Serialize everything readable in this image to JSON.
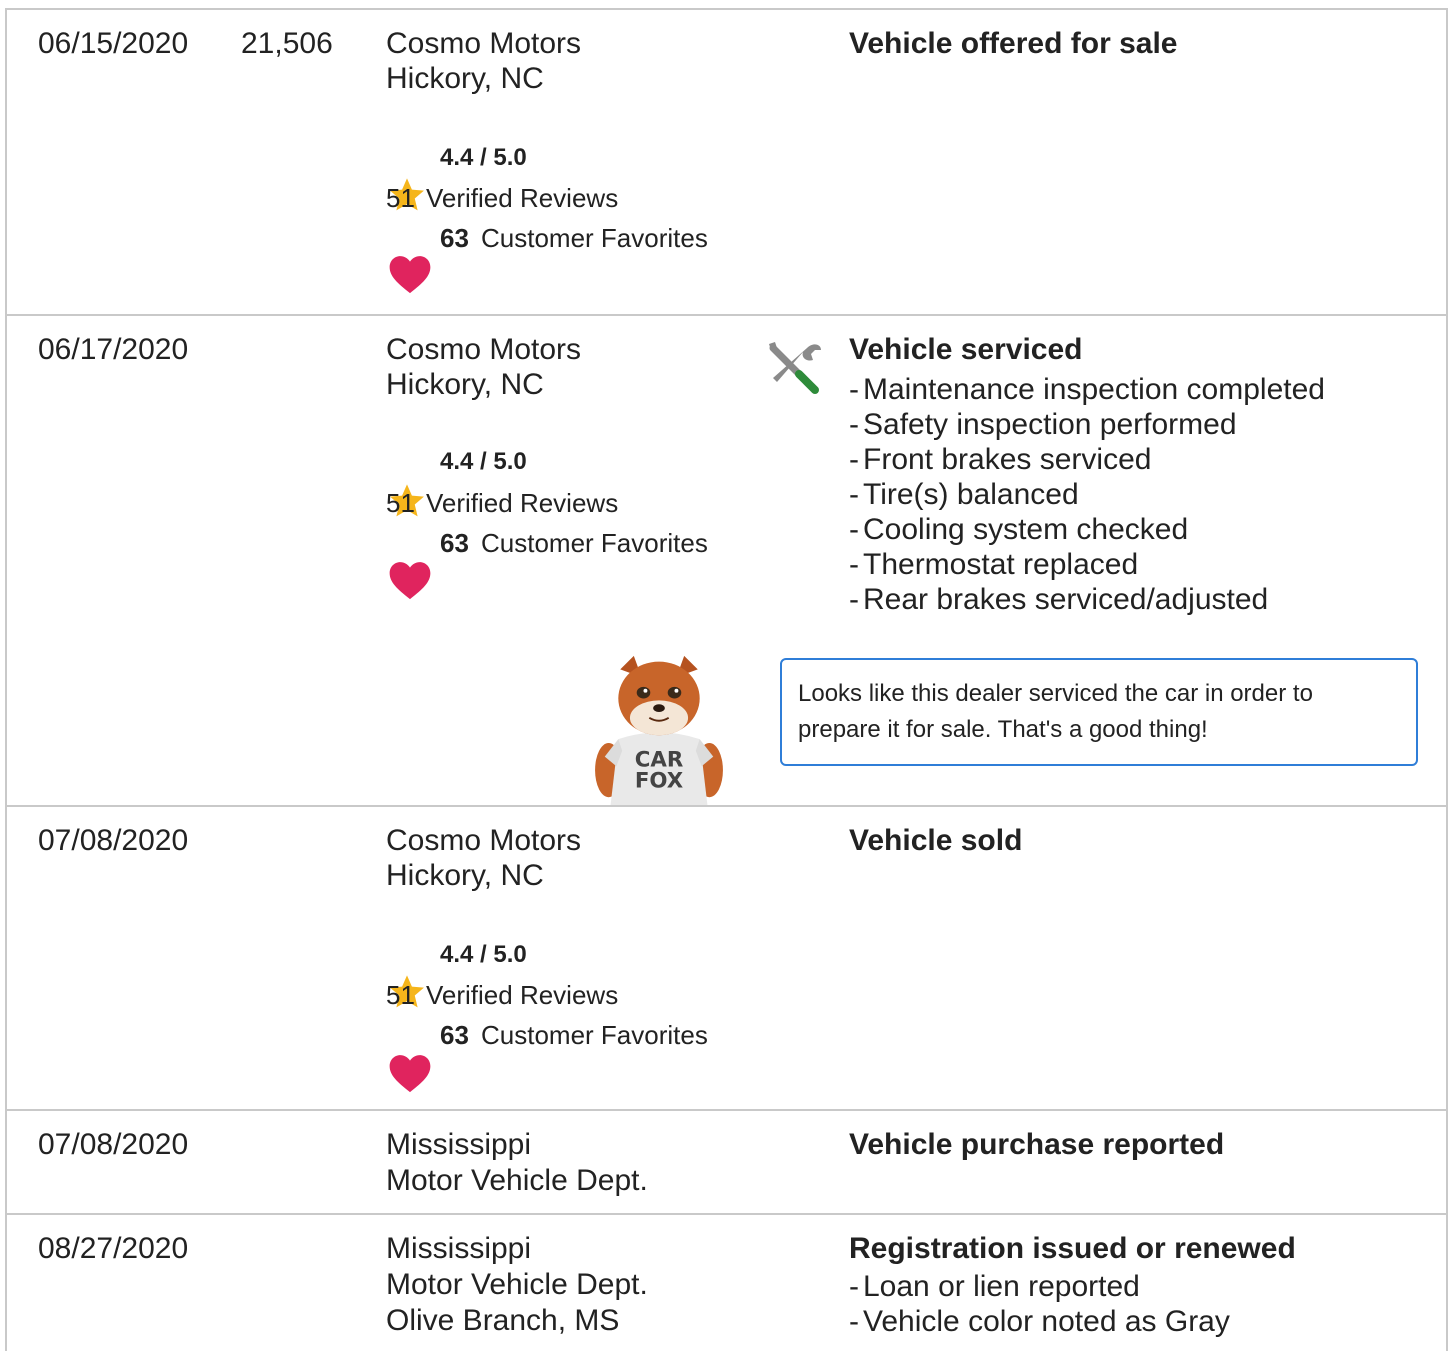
{
  "records": [
    {
      "date": "06/15/2020",
      "mileage": "21,506",
      "source_line1": "Cosmo Motors",
      "source_line2": "Hickory, NC",
      "rating": "4.4 / 5.0",
      "reviews_count": "51",
      "reviews_label": "Verified Reviews",
      "favorites_count": "63",
      "favorites_label": "Customer Favorites",
      "event_title": "Vehicle offered for sale"
    },
    {
      "date": "06/17/2020",
      "mileage": "",
      "source_line1": "Cosmo Motors",
      "source_line2": "Hickory, NC",
      "rating": "4.4 / 5.0",
      "reviews_count": "51",
      "reviews_label": "Verified Reviews",
      "favorites_count": "63",
      "favorites_label": "Customer Favorites",
      "event_icon": "service-tools-icon",
      "event_title": "Vehicle serviced",
      "event_details": [
        "Maintenance inspection completed",
        "Safety inspection performed",
        "Front brakes serviced",
        "Tire(s) balanced",
        "Cooling system checked",
        "Thermostat replaced",
        "Rear brakes serviced/adjusted"
      ],
      "tip_text": "Looks like this dealer serviced the car in order to prepare it for sale. That's a good thing!",
      "mascot_shirt_line1": "CAR",
      "mascot_shirt_line2": "FOX"
    },
    {
      "date": "07/08/2020",
      "mileage": "",
      "source_line1": "Cosmo Motors",
      "source_line2": "Hickory, NC",
      "rating": "4.4 / 5.0",
      "reviews_count": "51",
      "reviews_label": "Verified Reviews",
      "favorites_count": "63",
      "favorites_label": "Customer Favorites",
      "event_title": "Vehicle sold"
    },
    {
      "date": "07/08/2020",
      "mileage": "",
      "source_line1": "Mississippi",
      "source_line2": "Motor Vehicle Dept.",
      "event_title": "Vehicle purchase reported"
    },
    {
      "date": "08/27/2020",
      "mileage": "",
      "source_line1": "Mississippi",
      "source_line2": "Motor Vehicle Dept.",
      "source_line3": "Olive Branch, MS",
      "event_title": "Registration issued or renewed",
      "event_details": [
        "Loan or lien reported",
        "Vehicle color noted as Gray"
      ]
    }
  ],
  "colors": {
    "border": "#c9c9c9",
    "star": "#f5b51b",
    "heart": "#e0245e",
    "tip_border": "#2f7ed8",
    "tool_gray": "#8a8a8a",
    "tool_green": "#2e8b3a"
  },
  "icons": {
    "star": "star-icon",
    "heart": "heart-icon",
    "service": "service-tools-icon",
    "mascot": "carfox-mascot"
  }
}
